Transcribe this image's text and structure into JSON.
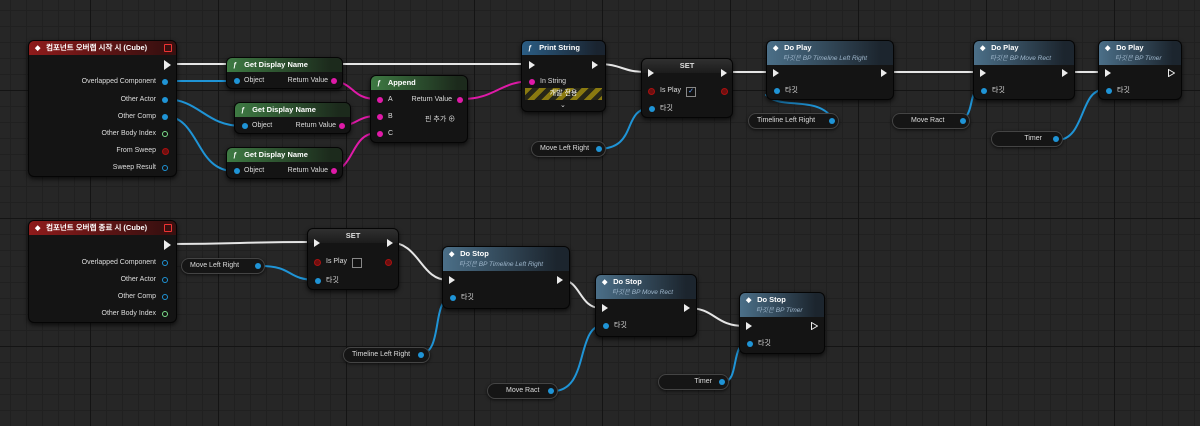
{
  "event1": {
    "title": "컴포넌트 오버랩 시작 시 (Cube)",
    "pins": [
      "Overlapped Component",
      "Other Actor",
      "Other Comp",
      "Other Body Index",
      "From Sweep",
      "Sweep Result"
    ]
  },
  "event2": {
    "title": "컴포넌트 오버랩 종료 시 (Cube)",
    "pins": [
      "Overlapped Component",
      "Other Actor",
      "Other Comp",
      "Other Body Index"
    ]
  },
  "getDisplayName": {
    "title": "Get Display Name",
    "object": "Object",
    "ret": "Return Value"
  },
  "append": {
    "title": "Append",
    "a": "A",
    "b": "B",
    "c": "C",
    "ret": "Return Value",
    "addpin": "핀 추가"
  },
  "printString": {
    "title": "Print String",
    "inString": "In String",
    "dev": "개발 전용"
  },
  "setNode": {
    "title": "SET",
    "isPlay": "Is Play",
    "target": "타깃",
    "check": "✓"
  },
  "doPlayTimeline": {
    "title": "Do Play",
    "sub": "타깃은 BP Timeline Left Right",
    "target": "타깃"
  },
  "doPlayMove": {
    "title": "Do Play",
    "sub": "타깃은 BP Move Rect",
    "target": "타깃"
  },
  "doPlayTimer": {
    "title": "Do Play",
    "sub": "타깃은 BP Timer",
    "target": "타깃"
  },
  "doStopTimeline": {
    "title": "Do Stop",
    "sub": "타깃은 BP Timeline Left Right",
    "target": "타깃"
  },
  "doStopMove": {
    "title": "Do Stop",
    "sub": "타깃은 BP Move Rect",
    "target": "타깃"
  },
  "doStopTimer": {
    "title": "Do Stop",
    "sub": "타깃은 BP Timer",
    "target": "타깃"
  },
  "vars": {
    "moveLeftRight": "Move Left Right",
    "timelineLeftRight": "Timeline Left Right",
    "moveRact": "Move Ract",
    "timer": "Timer"
  },
  "icons": {
    "function": "ƒ",
    "event": "◆"
  },
  "colors": {
    "exec": "#e6e6e6",
    "object": "#1f94d6",
    "string": "#e01aa8",
    "event": "#8e1b1b",
    "function": "#3e7a43"
  }
}
